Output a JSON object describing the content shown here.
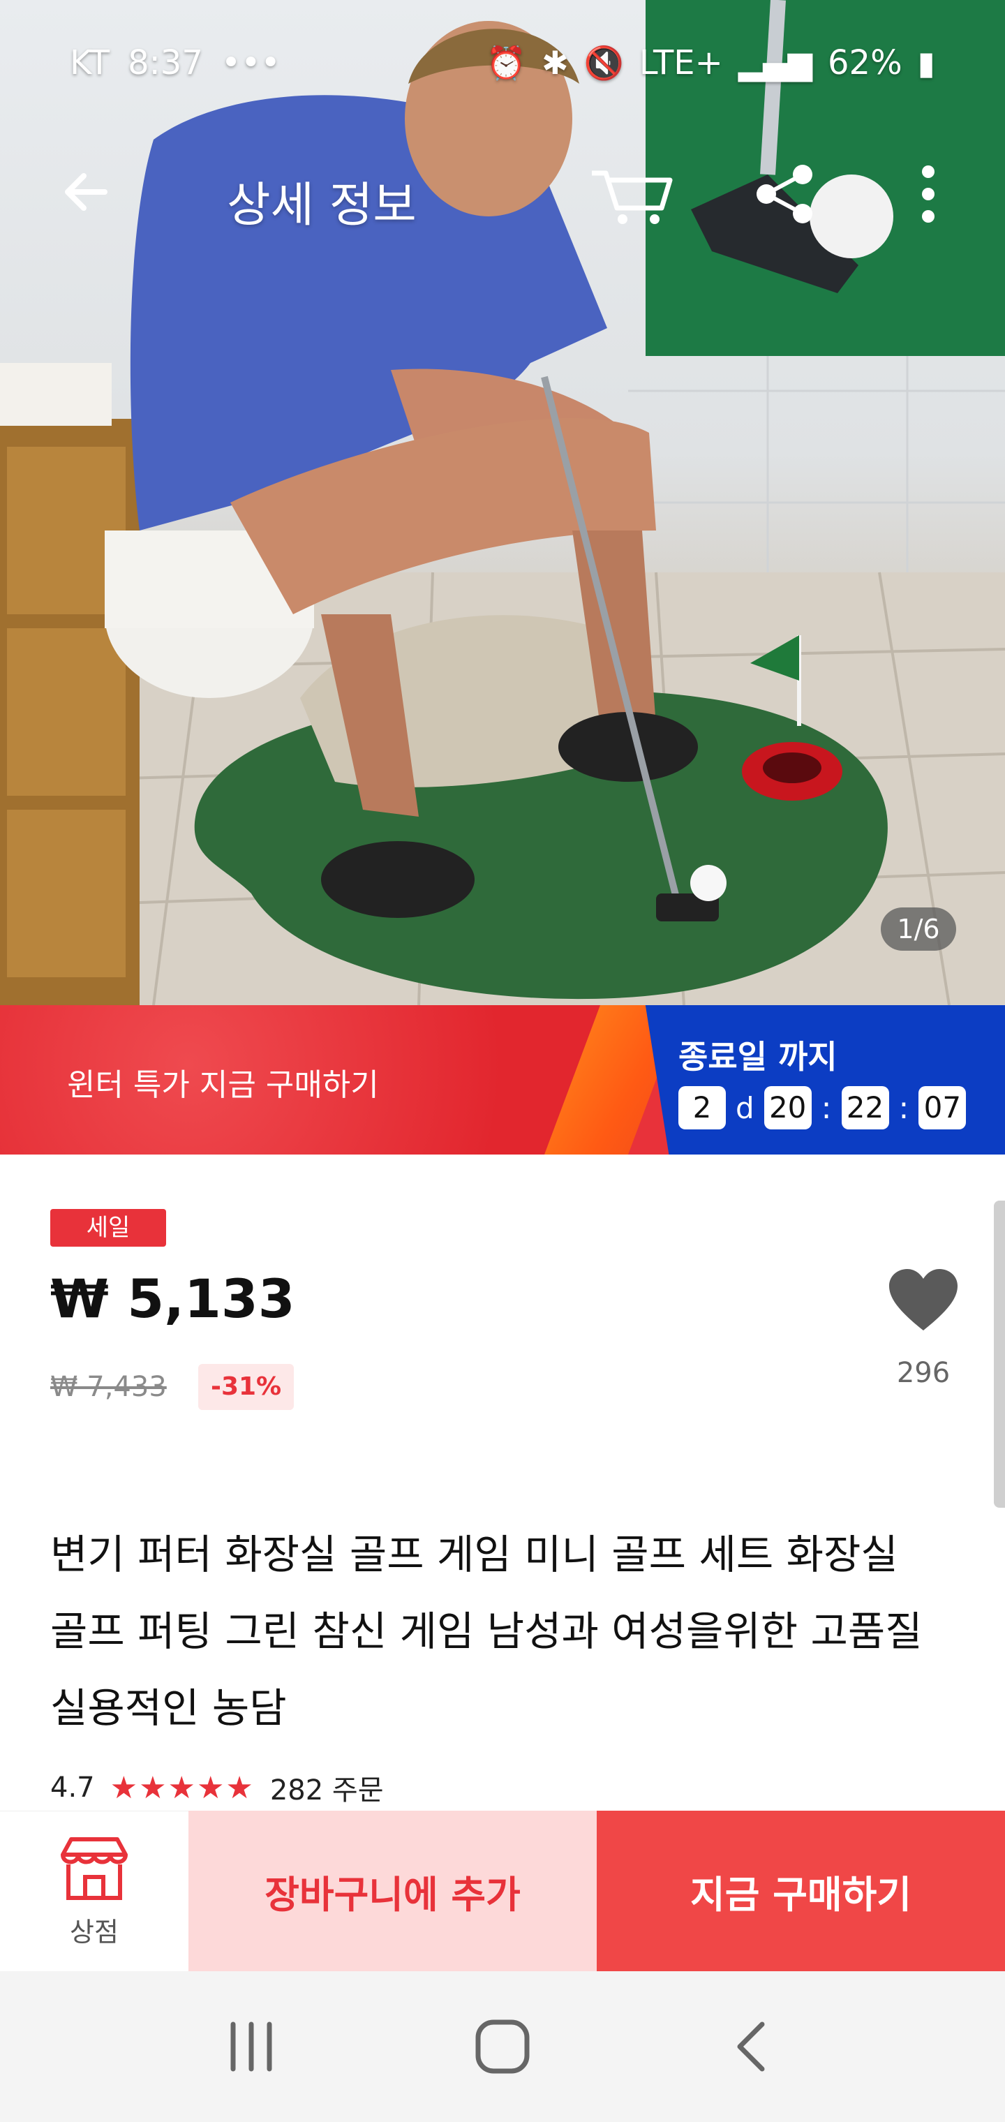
{
  "status_bar": {
    "carrier": "KT",
    "time": "8:37",
    "dots": "•••",
    "network": "LTE+",
    "battery": "62%"
  },
  "nav": {
    "title": "상세 정보",
    "back_icon": "arrow-left-icon",
    "cart_icon": "cart-icon",
    "share_icon": "share-icon",
    "more_icon": "more-vertical-icon"
  },
  "gallery": {
    "counter": "1/6"
  },
  "promo": {
    "text": "윈터 특가 지금 구매하기",
    "countdown_label": "종료일 까지",
    "days": "2",
    "day_unit": "d",
    "hours": "20",
    "minutes": "22",
    "seconds": "07",
    "colors": {
      "red": "#e8323a",
      "blue": "#0c3dc3",
      "orange": "#ff6a18"
    }
  },
  "product": {
    "sale_badge": "세일",
    "price": "₩ 5,133",
    "original_price": "₩ 7,433",
    "discount": "-31%",
    "wishlist_count": "296",
    "title": "변기 퍼터 화장실 골프 게임 미니 골프 세트 화장실 골프 퍼팅 그린 참신 게임 남성과 여성을위한 고품질 실용적인 농담",
    "rating": "4.7",
    "stars": "★★★★★",
    "orders": "282 주문"
  },
  "actions": {
    "store_label": "상점",
    "add_to_cart": "장바구니에 추가",
    "buy_now": "지금 구매하기",
    "colors": {
      "accent": "#f04747",
      "cart_bg": "#fdd9d9"
    }
  }
}
